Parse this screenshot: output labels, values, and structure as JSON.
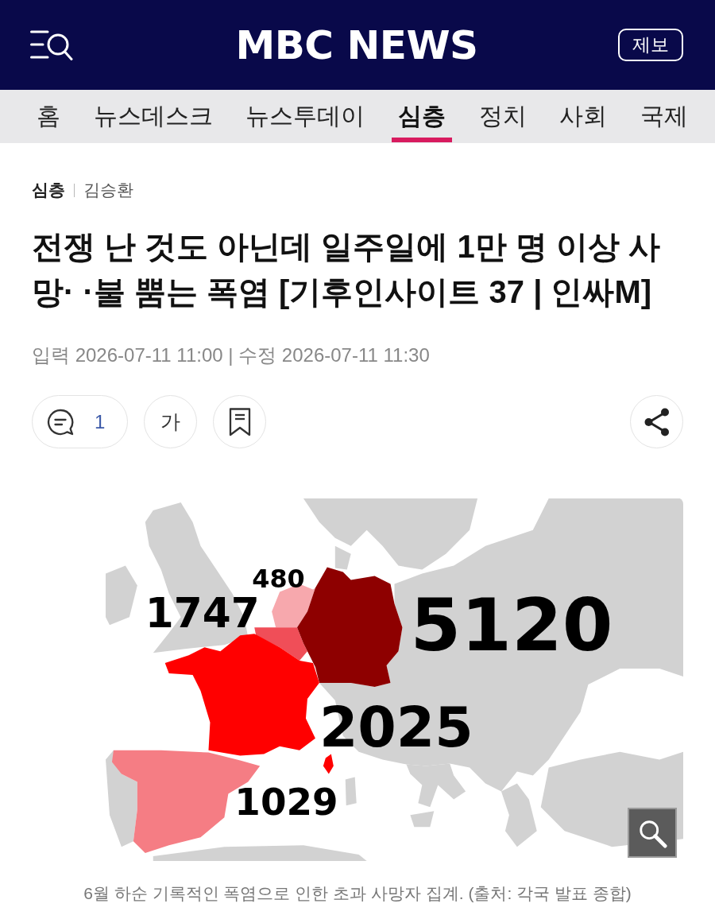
{
  "header": {
    "logo": "MBC NEWS",
    "report_button": "제보"
  },
  "nav": {
    "tabs": [
      {
        "label": "홈",
        "selected": false
      },
      {
        "label": "뉴스데스크",
        "selected": false
      },
      {
        "label": "뉴스투데이",
        "selected": false
      },
      {
        "label": "심층",
        "selected": true
      },
      {
        "label": "정치",
        "selected": false
      },
      {
        "label": "사회",
        "selected": false
      },
      {
        "label": "국제",
        "selected": false
      }
    ]
  },
  "article": {
    "category": "심층",
    "author": "김승환",
    "title": "전쟁 난 것도 아닌데 일주일에 1만 명 이상 사망· ·불 뿜는 폭염 [기후인사이트 37 | 인싸M]",
    "dates": "입력 2026-07-11 11:00 | 수정 2026-07-11 11:30"
  },
  "actions": {
    "comment_count": "1",
    "font_button": "가"
  },
  "figure": {
    "map": {
      "regions": [
        {
          "value": "480",
          "color": "#f7a8ad"
        },
        {
          "value": "1747",
          "color": "#f04e58"
        },
        {
          "value": "5120",
          "color": "#8e0000"
        },
        {
          "value": "2025",
          "color": "#ff0000"
        },
        {
          "value": "1029",
          "color": "#f57d84"
        }
      ]
    },
    "caption": "6월 하순 기록적인 폭염으로 인한 초과 사망자 집계. (출처: 각국 발표 종합)"
  }
}
